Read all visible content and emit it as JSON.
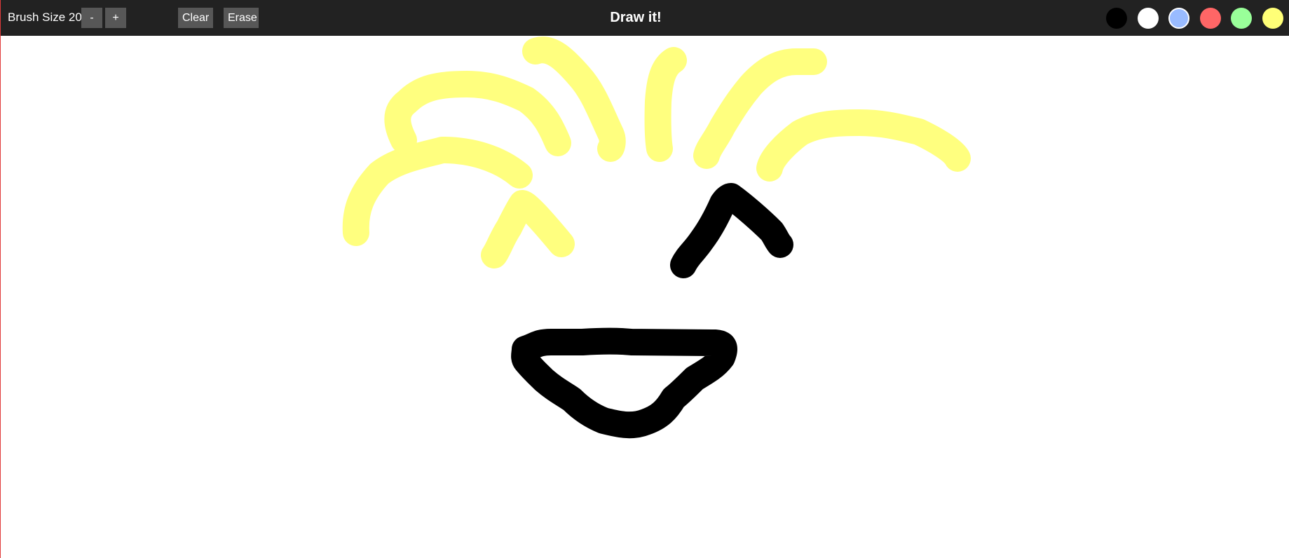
{
  "toolbar": {
    "brush_size_label": "Brush Size 20",
    "brush_size": 20,
    "decrease_label": "-",
    "increase_label": "+",
    "clear_label": "Clear",
    "erase_label": "Erase",
    "title": "Draw it!"
  },
  "palette": [
    {
      "name": "black",
      "color": "#000000",
      "selected": false
    },
    {
      "name": "white",
      "color": "#ffffff",
      "selected": false
    },
    {
      "name": "blue",
      "color": "#99bbff",
      "selected": true
    },
    {
      "name": "red",
      "color": "#ff6666",
      "selected": false
    },
    {
      "name": "green",
      "color": "#99ff99",
      "selected": false
    },
    {
      "name": "yellow",
      "color": "#ffff77",
      "selected": false
    }
  ],
  "drawing": {
    "background": "#ffffff",
    "strokes": [
      {
        "part": "hair",
        "color": "#ffff7f"
      },
      {
        "part": "hair",
        "color": "#ffff7f"
      },
      {
        "part": "hair",
        "color": "#ffff7f"
      },
      {
        "part": "hair",
        "color": "#ffff7f"
      },
      {
        "part": "hair",
        "color": "#ffff7f"
      },
      {
        "part": "hair",
        "color": "#ffff7f"
      },
      {
        "part": "hair",
        "color": "#ffff7f"
      },
      {
        "part": "eye",
        "color": "#000000"
      },
      {
        "part": "eye",
        "color": "#000000"
      },
      {
        "part": "mouth",
        "color": "#ff6666"
      }
    ]
  }
}
